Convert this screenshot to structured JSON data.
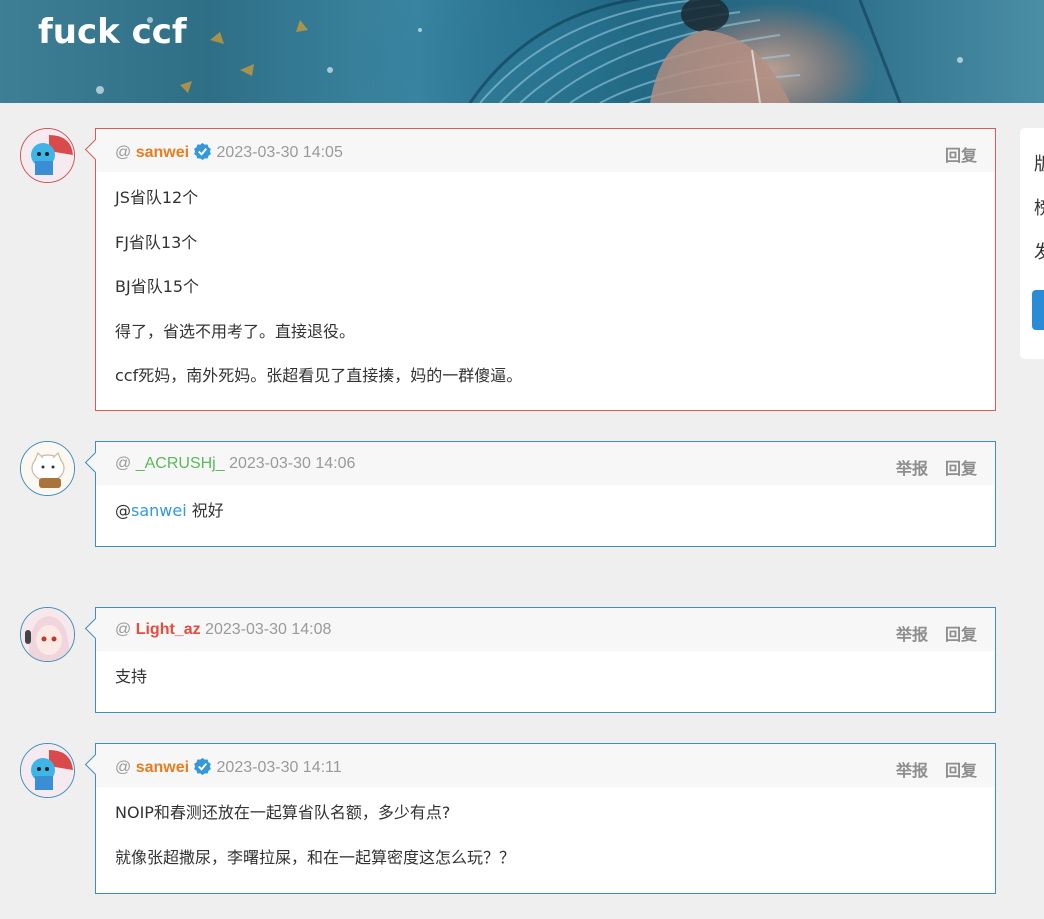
{
  "banner": {
    "title": "fuck ccf"
  },
  "comments": [
    {
      "at": "@",
      "user": "sanwei",
      "verified": true,
      "time": "2023-03-30 14:05",
      "actions": [
        "回复"
      ],
      "lines": [
        "JS省队12个",
        "FJ省队13个",
        "BJ省队15个",
        "得了，省选不用考了。直接退役。",
        "ccf死妈，南外死妈。张超看见了直接揍，妈的一群傻逼。"
      ]
    },
    {
      "at": "@",
      "user": "_ACRUSHj_",
      "time": "2023-03-30 14:06",
      "actions": [
        "举报",
        "回复"
      ],
      "mention_at": "@",
      "mention": "sanwei",
      "text": "祝好"
    },
    {
      "at": "@",
      "user": "Light_az",
      "time": "2023-03-30 14:08",
      "actions": [
        "举报",
        "回复"
      ],
      "lines": [
        "支持"
      ]
    },
    {
      "at": "@",
      "user": "sanwei",
      "verified": true,
      "time": "2023-03-30 14:11",
      "actions": [
        "举报",
        "回复"
      ],
      "lines": [
        "NOIP和春测还放在一起算省队名额，多少有点?",
        "就像张超撒尿，李曙拉屎，和在一起算密度这怎么玩？？"
      ]
    }
  ],
  "sidebar": {
    "chars": [
      "版",
      "榜",
      "发"
    ]
  },
  "colors": {
    "link": "#3498db",
    "accent_border": "#3e8fb8",
    "alert_border": "#d75c5c",
    "orange": "#e67e22",
    "green": "#5cb85c",
    "red": "#e74c3c"
  }
}
